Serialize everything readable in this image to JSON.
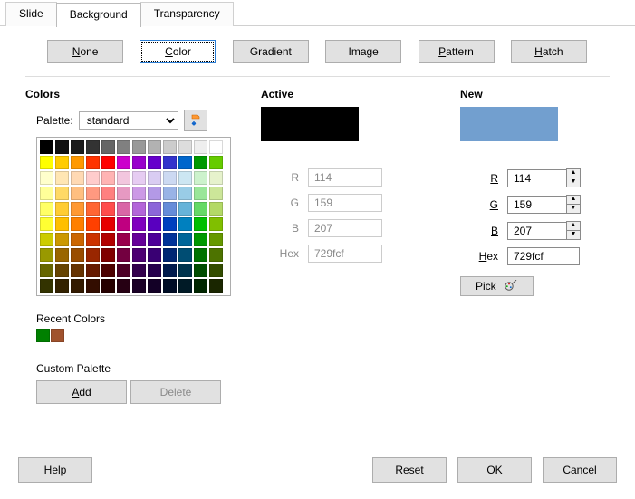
{
  "tabs": {
    "slide": "Slide",
    "background": "Background",
    "transparency": "Transparency"
  },
  "fill_types": {
    "none": "None",
    "color": "Color",
    "gradient": "Gradient",
    "image": "Image",
    "pattern": "Pattern",
    "hatch": "Hatch"
  },
  "sections": {
    "colors": "Colors",
    "active": "Active",
    "new": "New",
    "recent": "Recent Colors",
    "custom": "Custom Palette"
  },
  "palette": {
    "label": "Palette:",
    "selected": "standard"
  },
  "labels": {
    "r": "R",
    "g": "G",
    "b": "B",
    "hex": "Hex",
    "r_u": "R",
    "g_u": "G",
    "b_u": "B",
    "hex_h": "H",
    "hex_rest": "ex"
  },
  "active": {
    "swatch": "#000000",
    "r": "114",
    "g": "159",
    "b": "207",
    "hex": "729fcf"
  },
  "new": {
    "swatch": "#729fcf",
    "r": "114",
    "g": "159",
    "b": "207",
    "hex": "729fcf"
  },
  "buttons": {
    "pick": "Pick",
    "add": "Add",
    "delete": "Delete",
    "help": "Help",
    "reset": "Reset",
    "ok": "OK",
    "cancel": "Cancel"
  },
  "recent_colors": [
    "#008000",
    "#a0522d"
  ],
  "palette_grid": [
    [
      "#000000",
      "#111111",
      "#1c1c1c",
      "#333333",
      "#666666",
      "#808080",
      "#999999",
      "#b2b2b2",
      "#cccccc",
      "#dddddd",
      "#eeeeee",
      "#ffffff"
    ],
    [
      "#ffff00",
      "#ffcc00",
      "#ff9900",
      "#ff3300",
      "#ff0000",
      "#cc00cc",
      "#9900cc",
      "#6600cc",
      "#3333cc",
      "#0066cc",
      "#009900",
      "#66cc00"
    ],
    [
      "#ffffcc",
      "#ffe6b3",
      "#ffd9b3",
      "#ffcccc",
      "#ffb3b3",
      "#f2c6de",
      "#e6ccf2",
      "#d9ccf2",
      "#ccd9f2",
      "#cce6f2",
      "#ccf2cc",
      "#e6f2cc"
    ],
    [
      "#ffff99",
      "#ffd966",
      "#ffbf80",
      "#ff9980",
      "#ff8080",
      "#e699c2",
      "#cc99e6",
      "#b399e6",
      "#99b3e6",
      "#99cce6",
      "#99e699",
      "#cce699"
    ],
    [
      "#ffff66",
      "#ffcc33",
      "#ff9933",
      "#ff6633",
      "#ff4d4d",
      "#d966a6",
      "#b366d9",
      "#8c66d9",
      "#668cd9",
      "#66b3d9",
      "#66d966",
      "#b3d966"
    ],
    [
      "#ffff33",
      "#ffbf00",
      "#ff8000",
      "#ff4000",
      "#e60000",
      "#bf0080",
      "#8000bf",
      "#5900bf",
      "#0040bf",
      "#0080bf",
      "#00bf00",
      "#80bf00"
    ],
    [
      "#cccc00",
      "#cc9900",
      "#cc6600",
      "#cc3300",
      "#b30000",
      "#99004d",
      "#660099",
      "#4d0099",
      "#003399",
      "#006699",
      "#009900",
      "#669900"
    ],
    [
      "#999900",
      "#996600",
      "#994d00",
      "#992600",
      "#800000",
      "#730040",
      "#4d0073",
      "#390073",
      "#002673",
      "#004d73",
      "#007300",
      "#4d7300"
    ],
    [
      "#666600",
      "#664400",
      "#663300",
      "#661a00",
      "#4d0000",
      "#4d0026",
      "#33004d",
      "#26004d",
      "#001a4d",
      "#00334d",
      "#004d00",
      "#334d00"
    ],
    [
      "#333300",
      "#332200",
      "#331a00",
      "#330d00",
      "#260000",
      "#260013",
      "#1a0026",
      "#130026",
      "#000d26",
      "#001a26",
      "#002600",
      "#1a2600"
    ]
  ]
}
